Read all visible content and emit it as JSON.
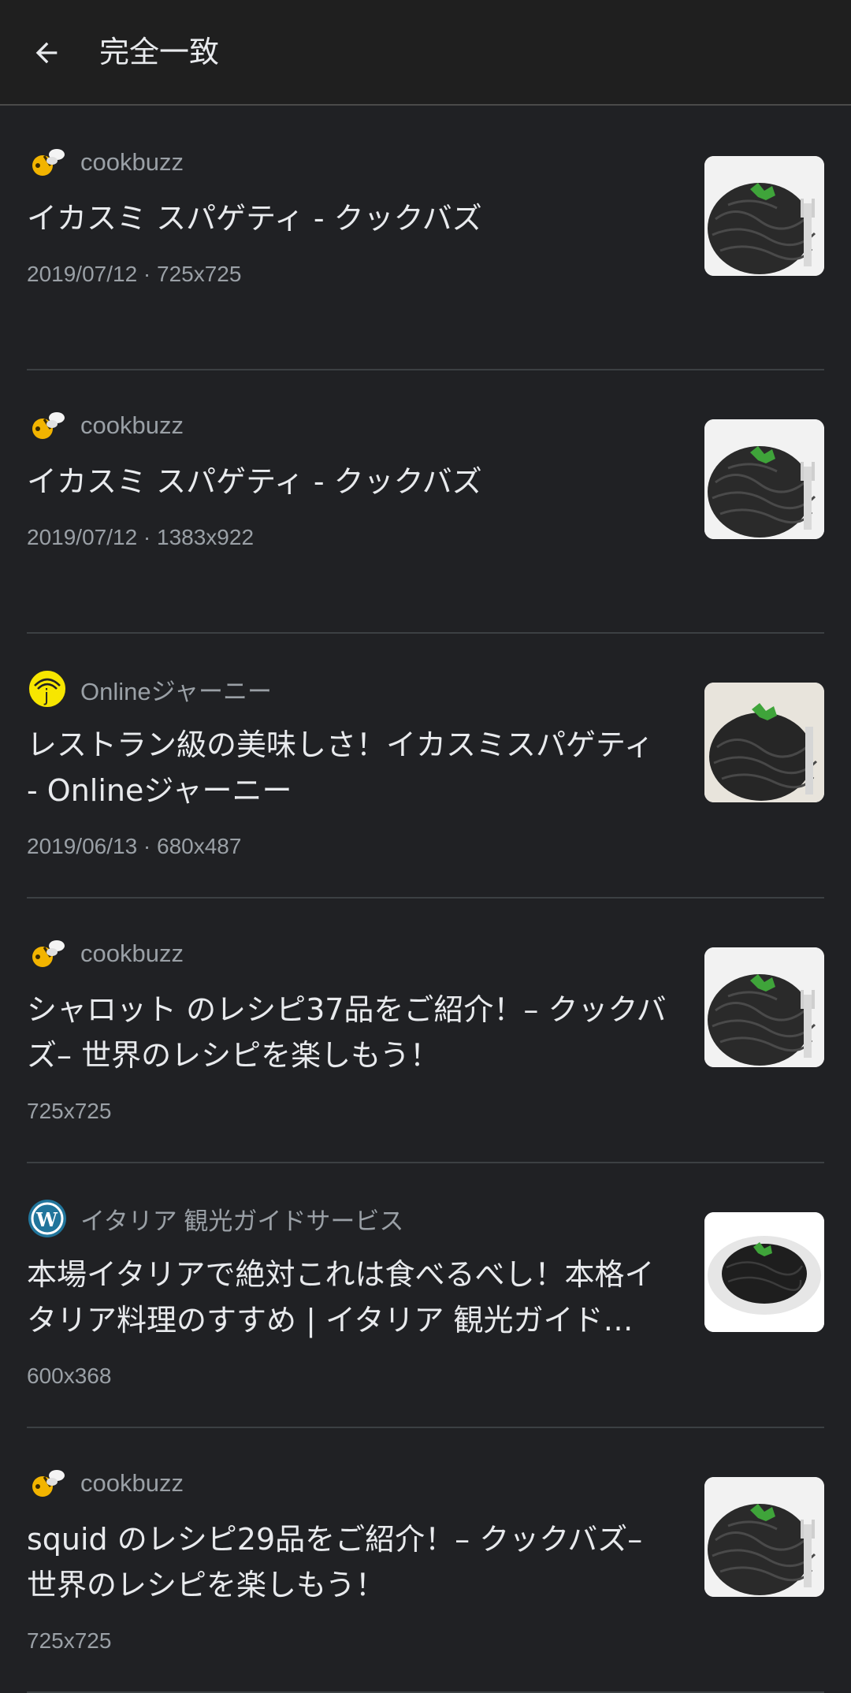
{
  "header": {
    "title": "完全一致"
  },
  "results": [
    {
      "source": "cookbuzz",
      "favicon": "bee-icon",
      "title": "イカスミ スパゲティ - クックバズ",
      "meta": "2019/07/12 · 725x725",
      "thumb": "squid-ink-pasta-fork"
    },
    {
      "source": "cookbuzz",
      "favicon": "bee-icon",
      "title": "イカスミ スパゲティ - クックバズ",
      "meta": "2019/07/12 · 1383x922",
      "thumb": "squid-ink-pasta-fork"
    },
    {
      "source": "Onlineジャーニー",
      "favicon": "onlinejourney-icon",
      "title": "レストラン級の美味しさ！イカスミスパゲティ - Onlineジャーニー",
      "meta": "2019/06/13 · 680x487",
      "thumb": "squid-ink-pasta-fork"
    },
    {
      "source": "cookbuzz",
      "favicon": "bee-icon",
      "title": "シャロット のレシピ37品をご紹介！– クックバズ– 世界のレシピを楽しもう！",
      "meta": "725x725",
      "thumb": "squid-ink-pasta-fork"
    },
    {
      "source": "イタリア 観光ガイドサービス",
      "favicon": "wordpress-icon",
      "title": "本場イタリアで絶対これは食べるべし！本格イタリア料理のすすめ | イタリア 観光ガイド…",
      "meta": "600x368",
      "thumb": "squid-ink-pasta-plate"
    },
    {
      "source": "cookbuzz",
      "favicon": "bee-icon",
      "title": "squid のレシピ29品をご紹介！– クックバズ– 世界のレシピを楽しもう！",
      "meta": "725x725",
      "thumb": "squid-ink-pasta-fork"
    }
  ],
  "colors": {
    "background": "#202124",
    "header": "#1f1f1f",
    "text": "#e8eaed",
    "secondary": "#9aa0a6",
    "divider": "#3c4043"
  }
}
